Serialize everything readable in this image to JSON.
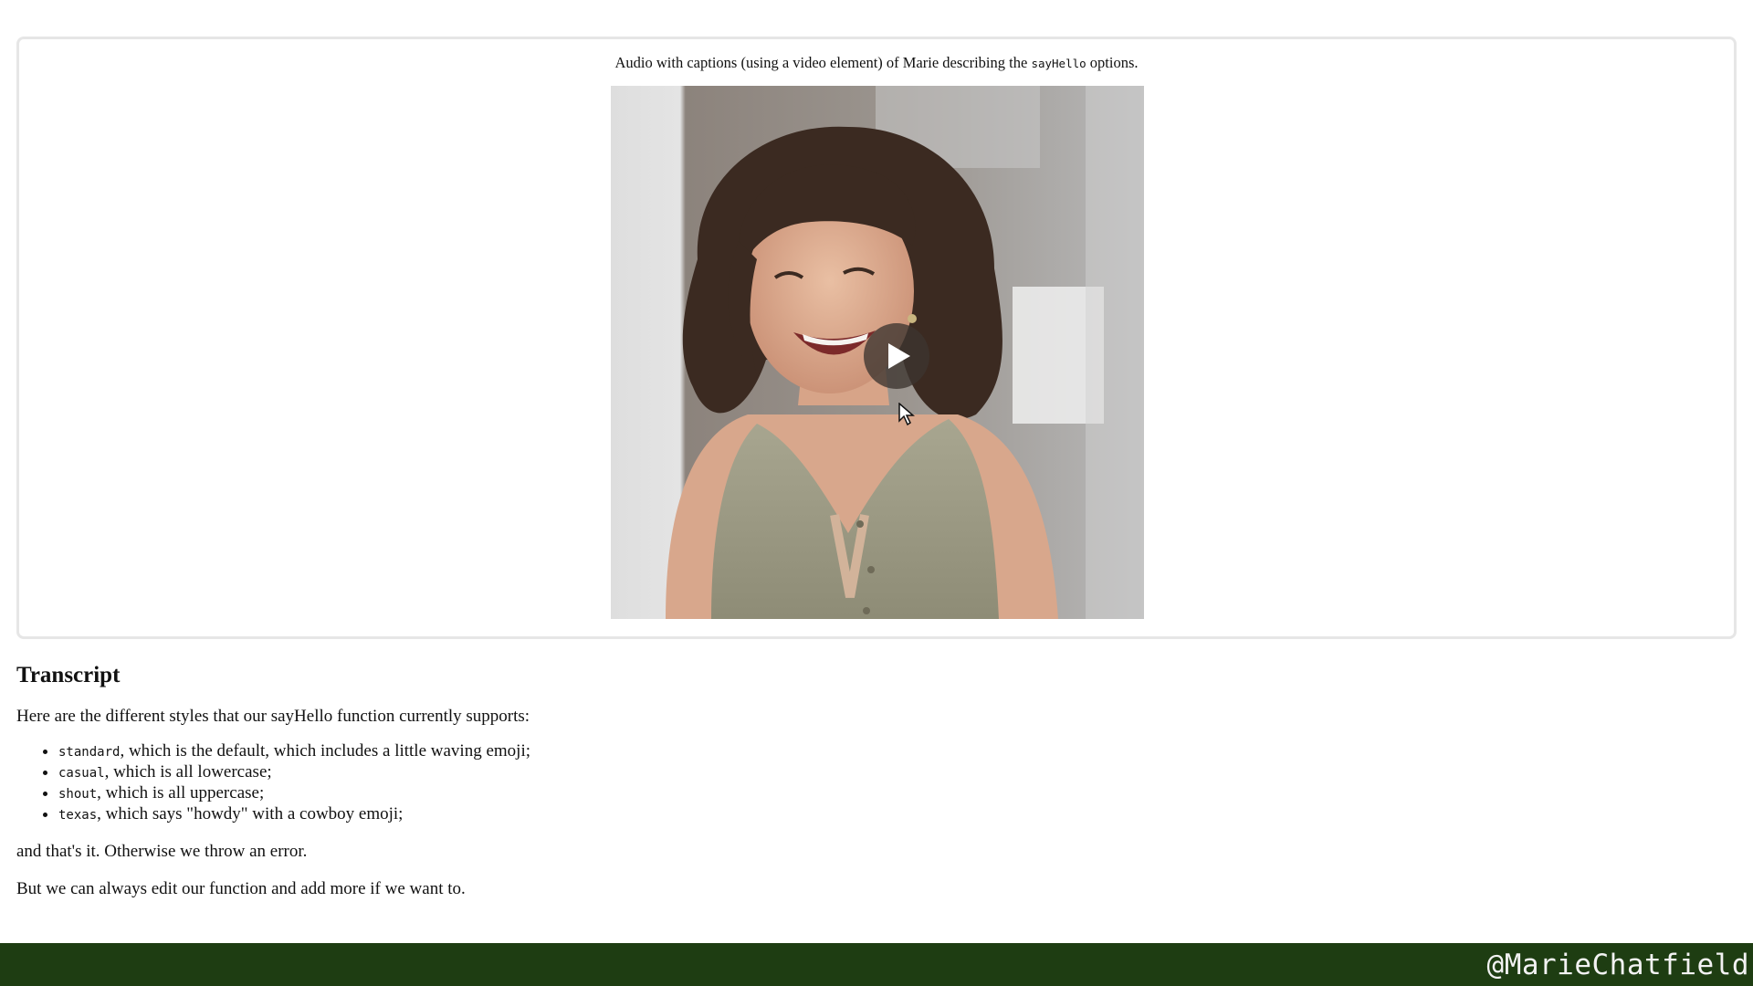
{
  "figure": {
    "caption_before": "Audio with captions (using a video element) of Marie describing the ",
    "caption_code": "sayHello",
    "caption_after": " options."
  },
  "video": {
    "play_icon": "play-icon",
    "cursor_icon": "cursor-arrow-icon"
  },
  "transcript": {
    "heading": "Transcript",
    "intro": "Here are the different styles that our sayHello function currently supports:",
    "items": [
      {
        "code": "standard",
        "text": ", which is the default, which includes a little waving emoji;"
      },
      {
        "code": "casual",
        "text": ", which is all lowercase;"
      },
      {
        "code": "shout",
        "text": ", which is all uppercase;"
      },
      {
        "code": "texas",
        "text": ", which says \"howdy\" with a cowboy emoji;"
      }
    ],
    "after_list": "and that's it. Otherwise we throw an error.",
    "closing": "But we can always edit our function and add more if we want to."
  },
  "footer": {
    "handle": "@MarieChatfield",
    "background": "#1e3d12"
  }
}
